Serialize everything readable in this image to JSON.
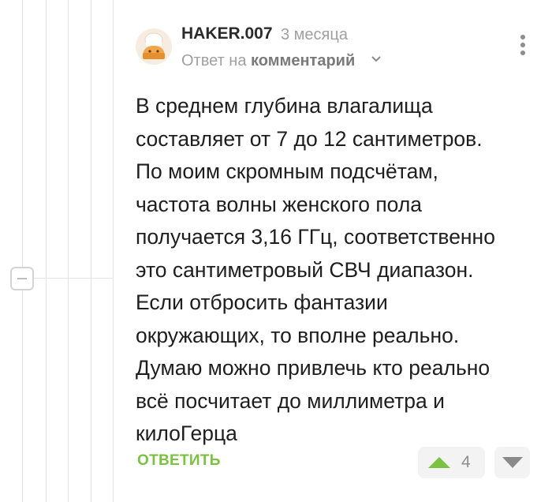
{
  "comment": {
    "username": "HAKER.007",
    "date": "3 месяца",
    "reply_to_prefix": "Ответ на",
    "reply_to_link": "комментарий",
    "text": "В среднем глубина влагалища\nсоставляет от 7 до 12 сантиметров.\nПо моим скромным подсчётам,\nчастота волны женского пола\nполучается 3,16 ГГц, соответственно\nэто сантиметровый СВЧ диапазон.\nЕсли отбросить фантазии\nокружающих, то вполне реально.\nДумаю можно привлечь кто реально\nвсё посчитает до миллиметра и\nкилоГерца",
    "reply_label": "ОТВЕТИТЬ",
    "rating": "4"
  },
  "icons": {
    "avatar": "avatar-chef-cupcake",
    "more": "more-vertical-icon",
    "expand": "chevron-down-icon",
    "collapse": "minus-icon",
    "upvote": "upvote-icon",
    "downvote": "downvote-icon"
  },
  "colors": {
    "accent_green": "#7bc142",
    "muted_gray": "#a0a0a0",
    "thread_line": "#e3e3e3"
  }
}
